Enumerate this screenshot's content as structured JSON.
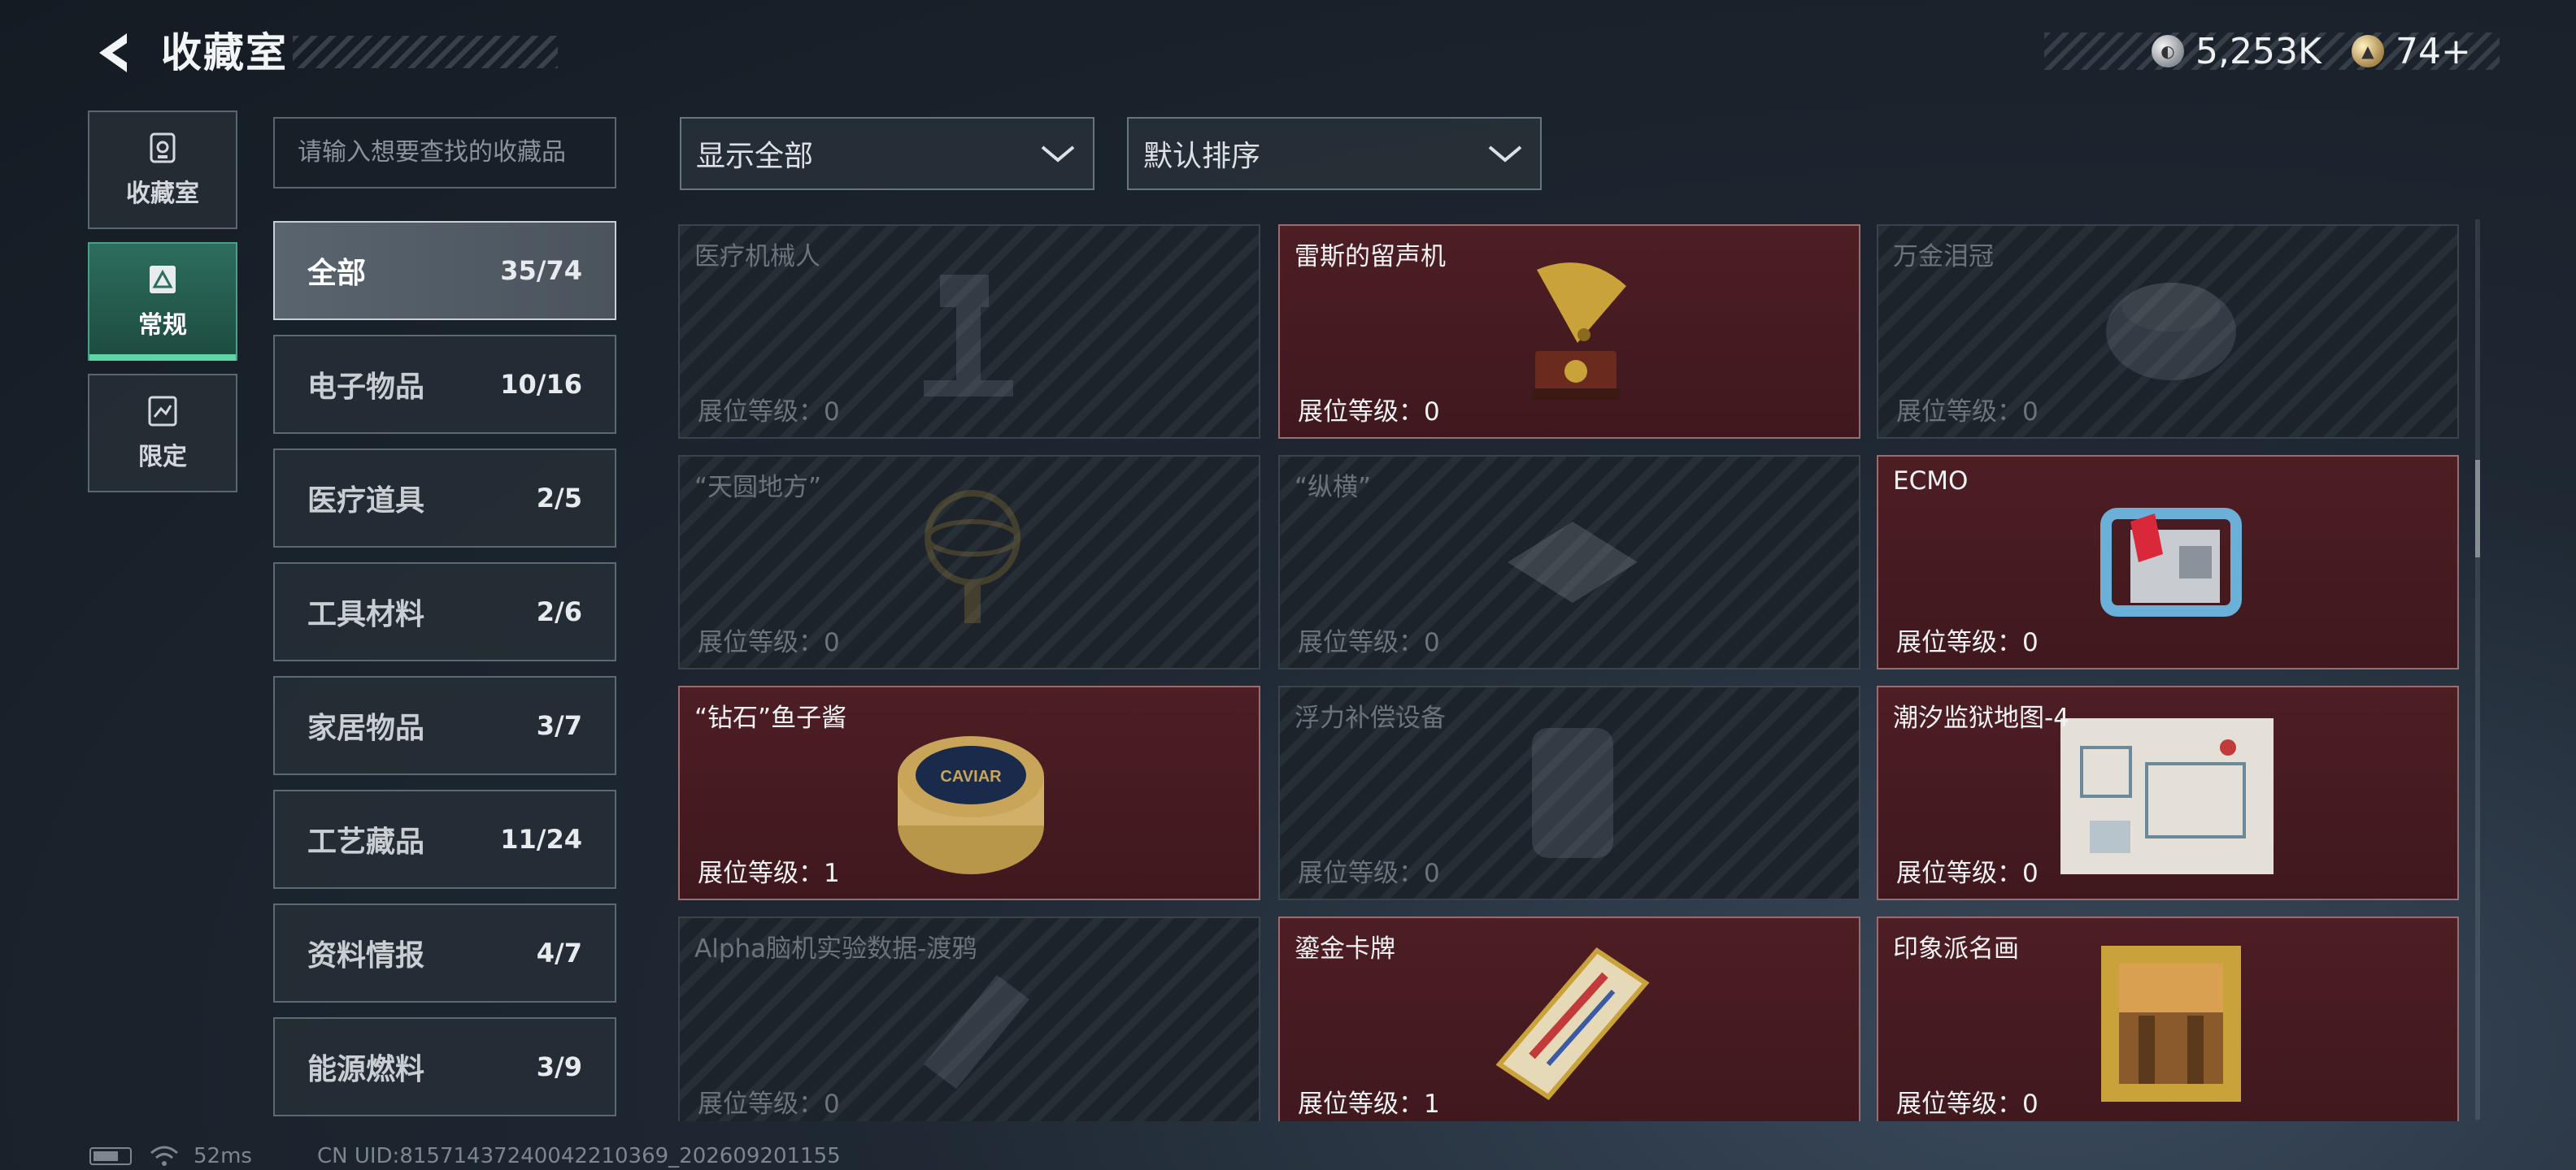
{
  "header": {
    "title": "收藏室",
    "back_icon": "chevron-left-icon",
    "currencies": [
      {
        "icon": "silver-coin-icon",
        "value": "5,253K"
      },
      {
        "icon": "gold-coin-icon",
        "value": "74+"
      }
    ]
  },
  "nav": [
    {
      "label": "收藏室",
      "icon": "collection-icon",
      "active": false
    },
    {
      "label": "常规",
      "icon": "regular-icon",
      "active": true
    },
    {
      "label": "限定",
      "icon": "limited-icon",
      "active": false
    }
  ],
  "search": {
    "placeholder": "请输入想要查找的收藏品"
  },
  "categories": [
    {
      "label": "全部",
      "count": "35/74",
      "active": true
    },
    {
      "label": "电子物品",
      "count": "10/16"
    },
    {
      "label": "医疗道具",
      "count": "2/5"
    },
    {
      "label": "工具材料",
      "count": "2/6"
    },
    {
      "label": "家居物品",
      "count": "3/7"
    },
    {
      "label": "工艺藏品",
      "count": "11/24"
    },
    {
      "label": "资料情报",
      "count": "4/7"
    },
    {
      "label": "能源燃料",
      "count": "3/9"
    }
  ],
  "filters": {
    "show": "显示全部",
    "sort": "默认排序"
  },
  "items": [
    {
      "name": "医疗机械人",
      "level": "展位等级：0",
      "owned": false,
      "icon": "medical-robot-icon"
    },
    {
      "name": "雷斯的留声机",
      "level": "展位等级：0",
      "owned": true,
      "icon": "gramophone-icon"
    },
    {
      "name": "万金泪冠",
      "level": "展位等级：0",
      "owned": false,
      "icon": "crown-icon"
    },
    {
      "name": "“天圆地方”",
      "level": "展位等级：0",
      "owned": false,
      "icon": "armillary-sphere-icon"
    },
    {
      "name": "“纵横”",
      "level": "展位等级：0",
      "owned": false,
      "icon": "chess-board-icon"
    },
    {
      "name": "ECMO",
      "level": "展位等级：0",
      "owned": true,
      "icon": "ecmo-machine-icon"
    },
    {
      "name": "“钻石”鱼子酱",
      "level": "展位等级：1",
      "owned": true,
      "icon": "caviar-tin-icon"
    },
    {
      "name": "浮力补偿设备",
      "level": "展位等级：0",
      "owned": false,
      "icon": "buoyancy-device-icon"
    },
    {
      "name": "潮汐监狱地图-4",
      "level": "展位等级：0",
      "owned": true,
      "icon": "map-icon"
    },
    {
      "name": "Alpha脑机实验数据-渡鸦",
      "level": "展位等级：0",
      "owned": false,
      "icon": "data-device-icon"
    },
    {
      "name": "鎏金卡牌",
      "level": "展位等级：1",
      "owned": true,
      "icon": "gilded-card-icon"
    },
    {
      "name": "印象派名画",
      "level": "展位等级：0",
      "owned": true,
      "icon": "framed-painting-icon"
    }
  ],
  "item_images": {
    "caviar_text": "CAVIAR"
  },
  "status": {
    "ping": "52ms",
    "uid": "CN UID:815714372400422103​69_202609201155"
  },
  "colors": {
    "owned_card": "#4d1e24",
    "locked_card": "#1b2229",
    "active_nav": "#2c6e5e",
    "active_nav_underline": "#5fd6a8"
  }
}
